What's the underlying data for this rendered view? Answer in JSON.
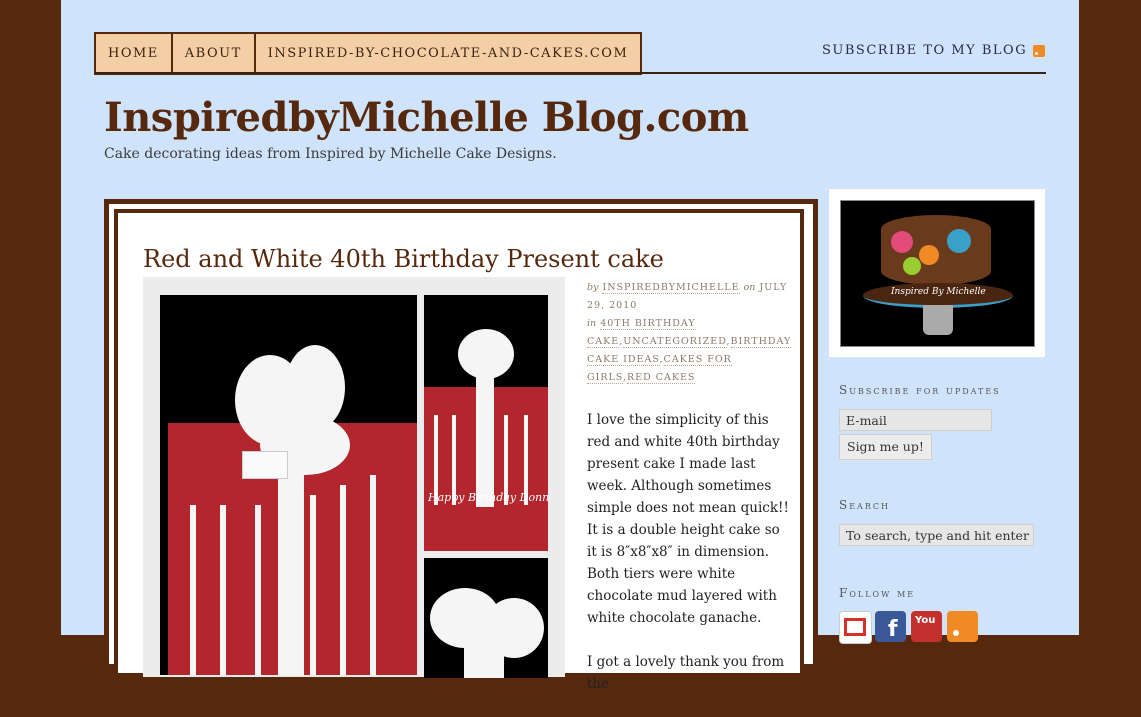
{
  "nav": {
    "items": [
      "HOME",
      "ABOUT",
      "INSPIRED-BY-CHOCOLATE-AND-CAKES.COM"
    ],
    "subscribe_label": "SUBSCRIBE TO MY BLOG"
  },
  "site": {
    "title": "InspiredbyMichelle Blog.com",
    "tagline": "Cake decorating ideas from Inspired by Michelle Cake Designs."
  },
  "post": {
    "title": "Red and White 40th Birthday Present cake",
    "meta": {
      "by": "by",
      "author": "INSPIREDBYMICHELLE",
      "on": "on",
      "date": "JULY 29, 2010",
      "in": "in",
      "categories": [
        "40TH BIRTHDAY CAKE",
        "UNCATEGORIZED",
        "BIRTHDAY CAKE IDEAS",
        "CAKES FOR GIRLS",
        "RED CAKES"
      ]
    },
    "paragraphs": [
      "I love the simplicity of this red and white 40th birthday present cake I made last week. Although sometimes simple does not mean quick!! It is a double height cake so it is 8″x8″x8″ in dimension. Both tiers were white chocolate mud layered with white chocolate ganache.",
      "I got a lovely thank you from the"
    ],
    "photo_caption": "Happy Birthday Donna"
  },
  "sidebar": {
    "photo_caption": "Inspired By Michelle",
    "subscribe_heading": "Subscribe for updates",
    "email_placeholder": "E-mail",
    "signup_label": "Sign me up!",
    "search_heading": "Search",
    "search_placeholder": "To search, type and hit enter",
    "follow_heading": "Follow me",
    "social_icons": [
      "gmail-icon",
      "facebook-icon",
      "youtube-icon",
      "rss-icon"
    ]
  },
  "colors": {
    "background": "#56290f",
    "page": "#cfe3fb",
    "nav": "#f4cfa6",
    "brand_brown": "#56290f",
    "cake_red": "#b3262d"
  }
}
